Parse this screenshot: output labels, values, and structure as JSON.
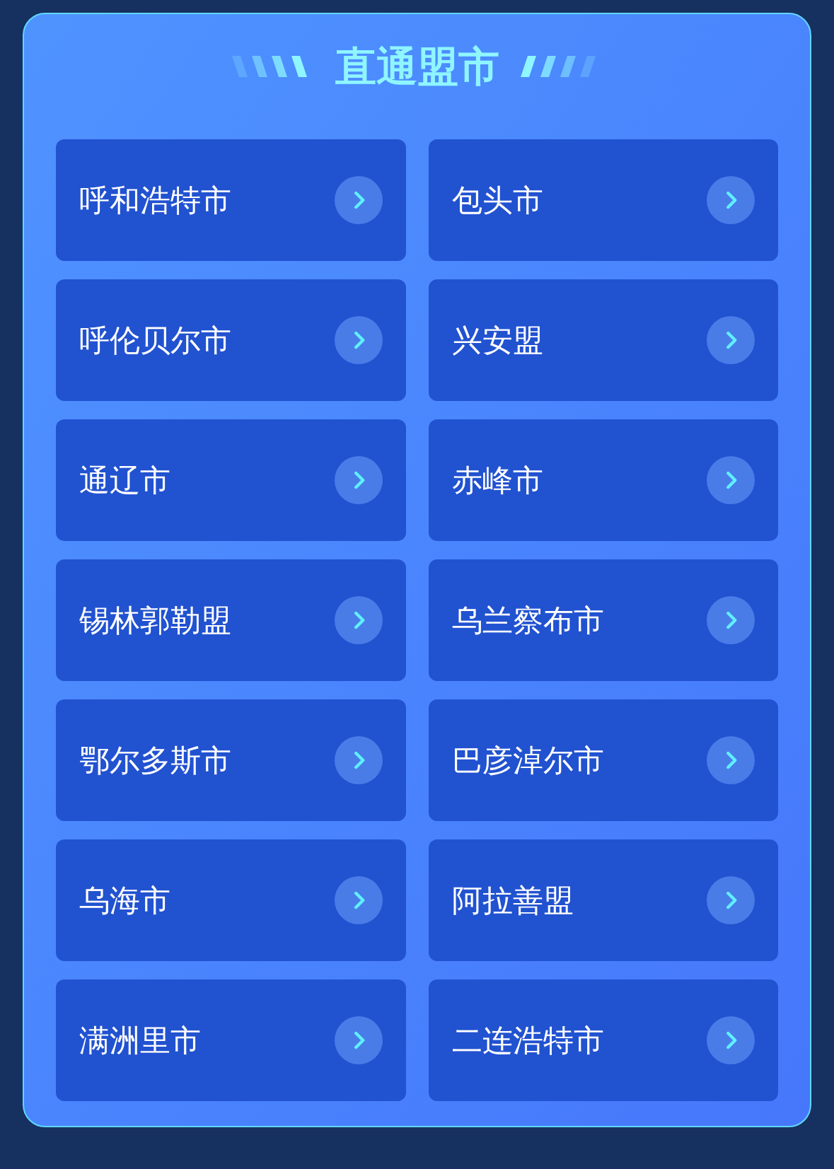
{
  "title": "直通盟市",
  "items": [
    {
      "label": "呼和浩特市"
    },
    {
      "label": "包头市"
    },
    {
      "label": "呼伦贝尔市"
    },
    {
      "label": "兴安盟"
    },
    {
      "label": "通辽市"
    },
    {
      "label": "赤峰市"
    },
    {
      "label": "锡林郭勒盟"
    },
    {
      "label": "乌兰察布市"
    },
    {
      "label": "鄂尔多斯市"
    },
    {
      "label": "巴彦淖尔市"
    },
    {
      "label": "乌海市"
    },
    {
      "label": "阿拉善盟"
    },
    {
      "label": "满洲里市"
    },
    {
      "label": "二连浩特市"
    }
  ]
}
